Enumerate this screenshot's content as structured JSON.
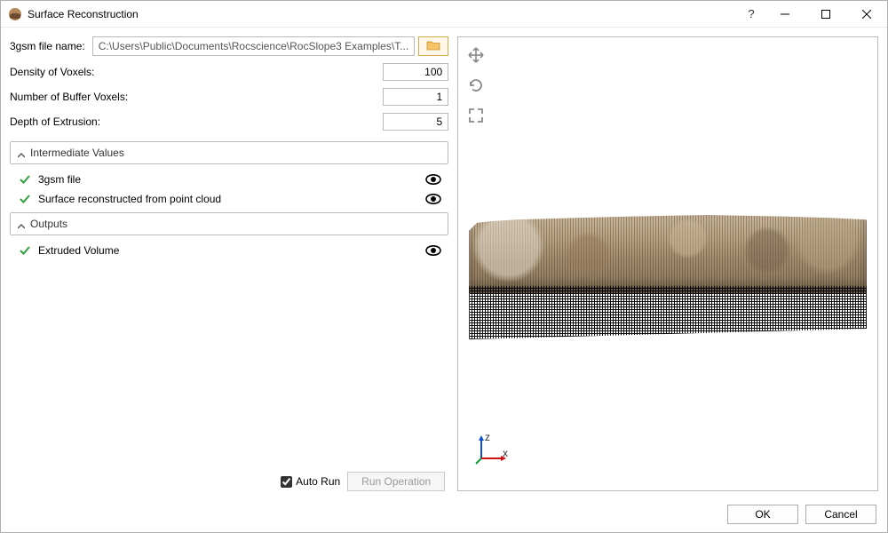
{
  "titlebar": {
    "title": "Surface Reconstruction"
  },
  "inputs": {
    "file_label": "3gsm file name:",
    "file_path": "C:\\Users\\Public\\Documents\\Rocscience\\RocSlope3 Examples\\T...",
    "density_label": "Density of Voxels:",
    "density_value": "100",
    "buffer_label": "Number of Buffer Voxels:",
    "buffer_value": "1",
    "depth_label": "Depth of Extrusion:",
    "depth_value": "5"
  },
  "sections": {
    "intermediate_header": "Intermediate Values",
    "intermediate_items": [
      {
        "label": "3gsm file"
      },
      {
        "label": "Surface reconstructed from point cloud"
      }
    ],
    "outputs_header": "Outputs",
    "outputs_items": [
      {
        "label": "Extruded Volume"
      }
    ]
  },
  "footer": {
    "auto_run_label": "Auto Run",
    "auto_run_checked": true,
    "run_button": "Run Operation",
    "ok": "OK",
    "cancel": "Cancel"
  },
  "axis": {
    "x": "x",
    "z": "z"
  }
}
